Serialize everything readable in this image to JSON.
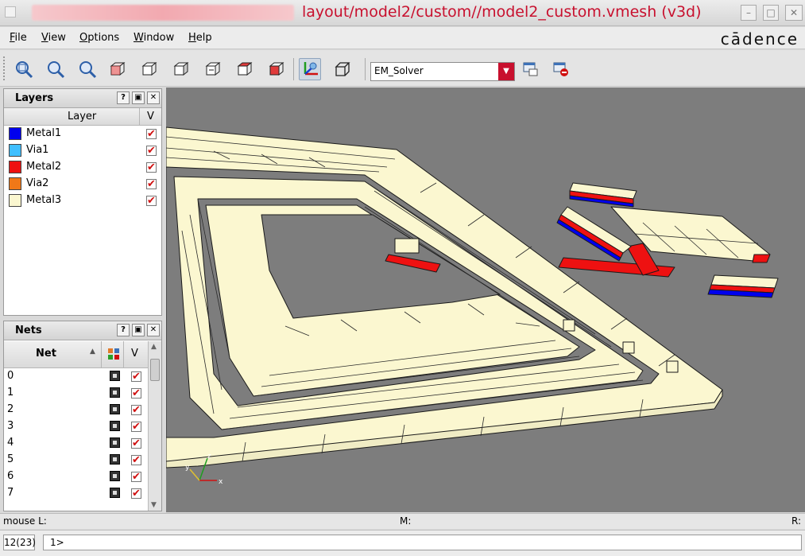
{
  "window": {
    "title": "layout/model2/custom//model2_custom.vmesh (v3d)",
    "brand": "cādence"
  },
  "menu": {
    "items": [
      {
        "label": "File",
        "mnemonic": "F",
        "rest": "ile"
      },
      {
        "label": "View",
        "mnemonic": "V",
        "rest": "iew"
      },
      {
        "label": "Options",
        "mnemonic": "O",
        "rest": "ptions"
      },
      {
        "label": "Window",
        "mnemonic": "W",
        "rest": "indow"
      },
      {
        "label": "Help",
        "mnemonic": "H",
        "rest": "elp"
      }
    ]
  },
  "toolbar": {
    "solver_value": "EM_Solver"
  },
  "layers_panel": {
    "title": "Layers",
    "col_layer": "Layer",
    "col_visible": "V",
    "rows": [
      {
        "name": "Metal1",
        "color": "#0000ee",
        "visible": true
      },
      {
        "name": "Via1",
        "color": "#3fbfff",
        "visible": true
      },
      {
        "name": "Metal2",
        "color": "#ee1111",
        "visible": true
      },
      {
        "name": "Via2",
        "color": "#f07818",
        "visible": true
      },
      {
        "name": "Metal3",
        "color": "#fbf7d0",
        "visible": true
      }
    ]
  },
  "nets_panel": {
    "title": "Nets",
    "col_net": "Net",
    "col_visible": "V",
    "rows": [
      "0",
      "1",
      "2",
      "3",
      "4",
      "5",
      "6",
      "7"
    ]
  },
  "panel_buttons": {
    "help": "?",
    "float": "▣",
    "close": "✕"
  },
  "viewport": {
    "background": "#7d7d7d",
    "axis_x": "x",
    "axis_y": "y",
    "axis_z": "z"
  },
  "status": {
    "mouse_l": "mouse L:",
    "mouse_m": "M:",
    "mouse_r": "R:"
  },
  "command": {
    "count": "12(23)",
    "prompt": "1>"
  }
}
